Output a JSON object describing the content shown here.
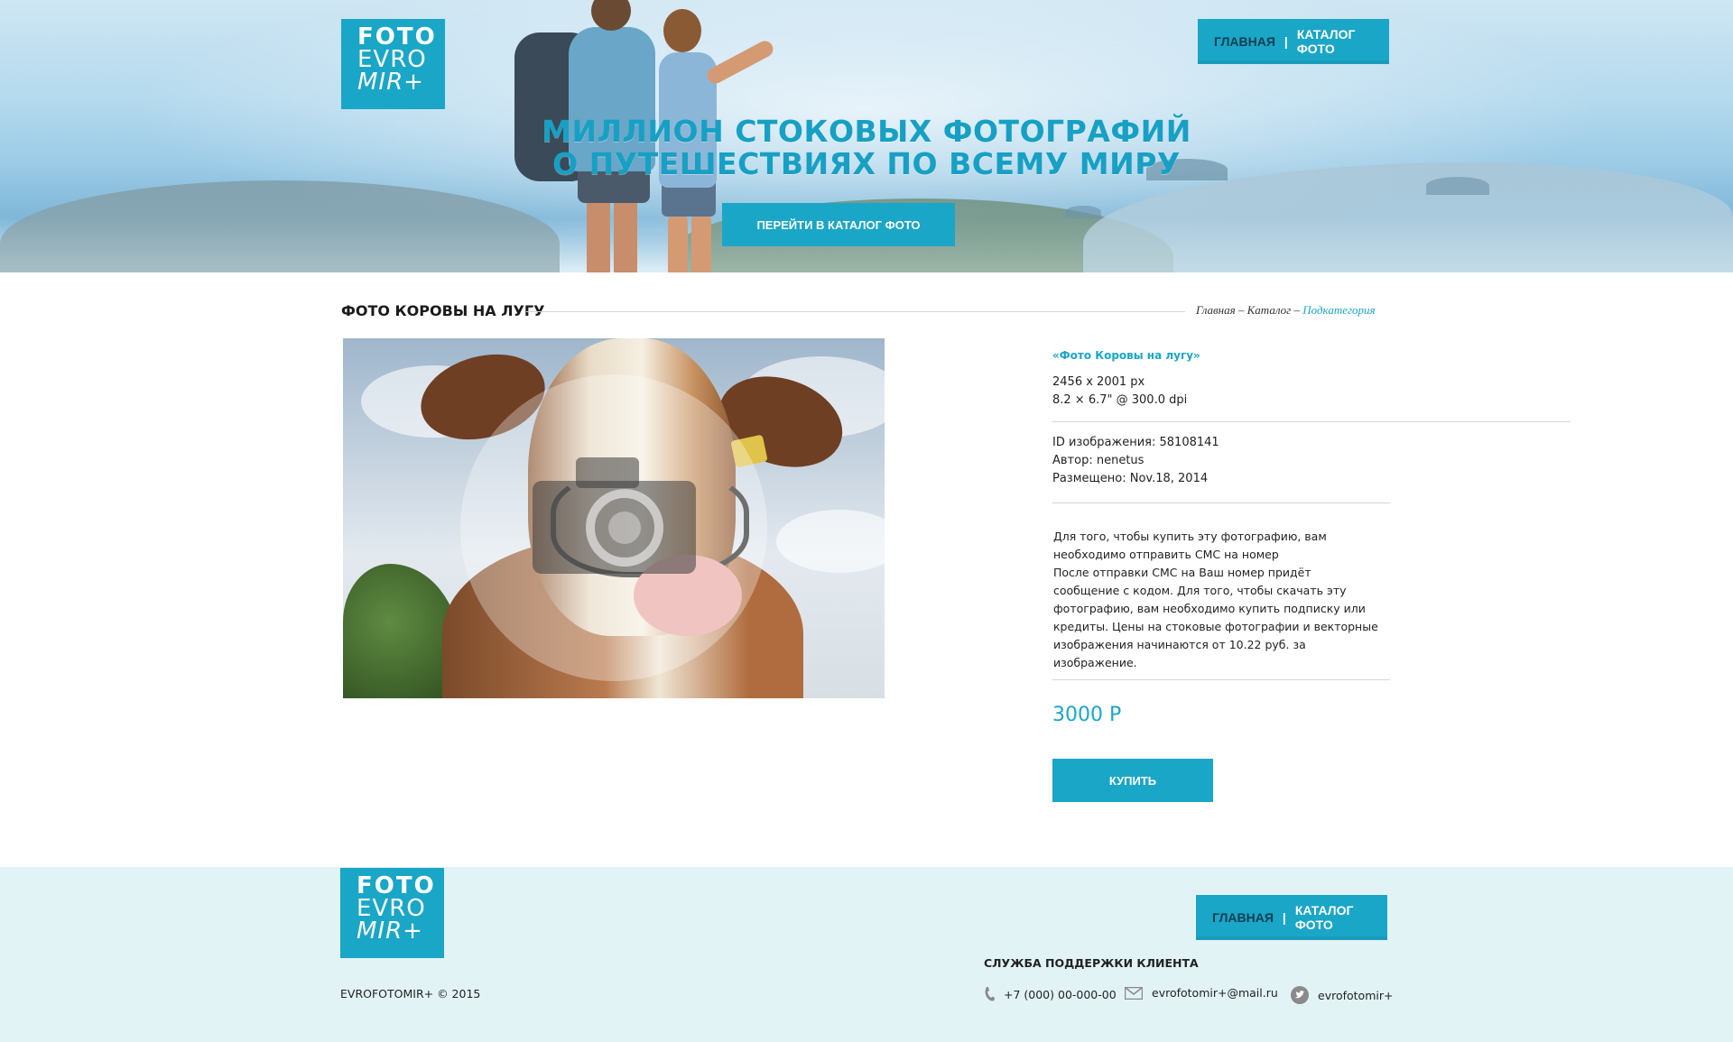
{
  "header": {
    "logo": {
      "line1": "FOTO",
      "line2": "EVRO",
      "line3": "MIR+"
    },
    "nav": {
      "home": "ГЛАВНАЯ",
      "separator": "|",
      "catalog": "КАТАЛОГ ФОТО"
    },
    "hero_title_line1": "МИЛЛИОН СТОКОВЫХ ФОТОГРАФИЙ",
    "hero_title_line2": "О ПУТЕШЕСТВИЯХ ПО ВСЕМУ МИРУ",
    "cta_label": "ПЕРЕЙТИ В КАТАЛОГ ФОТО"
  },
  "content": {
    "page_title": "ФОТО КОРОВЫ НА ЛУГУ",
    "breadcrumb": {
      "home": "Главная",
      "sep1": " – ",
      "catalog": "Каталог",
      "sep2": " – ",
      "current": "Подкатегория"
    },
    "photo_icon": "camera-icon"
  },
  "info": {
    "title": "«Фото Коровы на лугу»",
    "dimensions_px": "2456 x 2001 px",
    "dimensions_print": "8.2 × 6.7\" @ 300.0 dpi",
    "image_id": "ID изображения: 58108141",
    "author": "Автор: nenetus",
    "posted": "Размещено: Nov.18, 2014",
    "description_p1": "Для того, чтобы купить эту фотографию, вам необходимо отправить СМС на номер",
    "description_p2": "После отправки СМС на Ваш номер придёт сообщение с кодом.  Для того, чтобы скачать эту фотографию, вам необходимо купить подписку или кредиты. Цены на стоковые фотографии и векторные изображения начинаются от 10.22 руб. за изображение.",
    "price": "3000 Р",
    "buy_label": "КУПИТЬ"
  },
  "footer": {
    "logo": {
      "line1": "FOTO",
      "line2": "EVRO",
      "line3": "MIR+"
    },
    "nav": {
      "home": "ГЛАВНАЯ",
      "separator": "|",
      "catalog": "КАТАЛОГ ФОТО"
    },
    "copyright": "EVROFOTOMIR+ © 2015",
    "support_title": "СЛУЖБА ПОДДЕРЖКИ КЛИЕНТА",
    "phone": "+7 (000) 00-000-00",
    "email": "evrofotomir+@mail.ru",
    "twitter": "evrofotomir+",
    "icons": [
      "phone-icon",
      "mail-icon",
      "twitter-icon"
    ]
  },
  "colors": {
    "accent": "#1aa6c7",
    "nav_active": "#0d3e52",
    "footer_bg": "#e2f3f6",
    "divider": "#d5d5d5"
  }
}
